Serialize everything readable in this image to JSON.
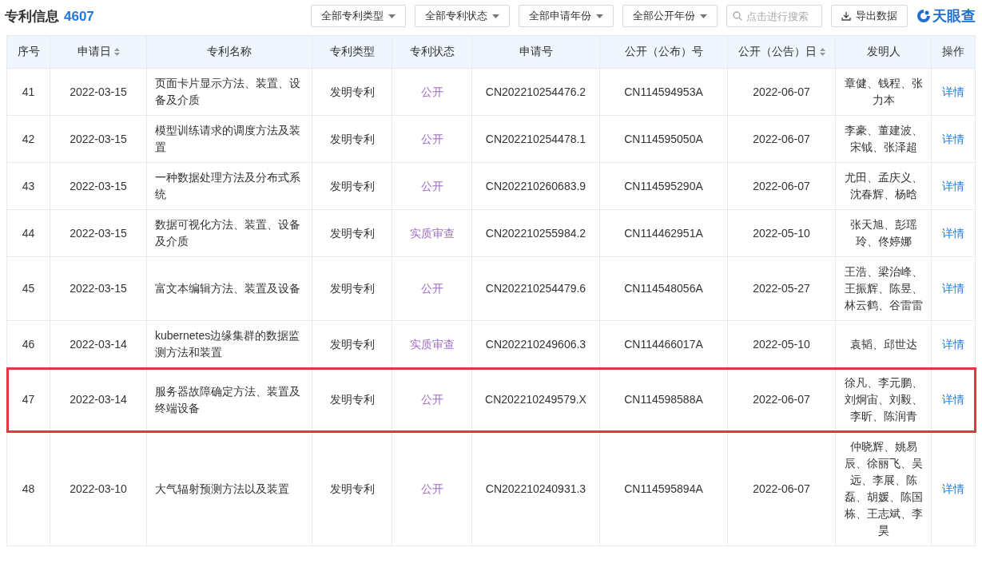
{
  "header": {
    "title": "专利信息",
    "count": "4607"
  },
  "filters": [
    {
      "label": "全部专利类型"
    },
    {
      "label": "全部专利状态"
    },
    {
      "label": "全部申请年份"
    },
    {
      "label": "全部公开年份"
    }
  ],
  "search": {
    "placeholder": "点击进行搜索"
  },
  "export_button": "导出数据",
  "logo": {
    "text": "天眼查"
  },
  "table": {
    "columns": [
      {
        "label": "序号",
        "sortable": false
      },
      {
        "label": "申请日",
        "sortable": true
      },
      {
        "label": "专利名称",
        "sortable": false
      },
      {
        "label": "专利类型",
        "sortable": false
      },
      {
        "label": "专利状态",
        "sortable": false
      },
      {
        "label": "申请号",
        "sortable": false
      },
      {
        "label": "公开（公布）号",
        "sortable": false
      },
      {
        "label": "公开（公告）日",
        "sortable": true
      },
      {
        "label": "发明人",
        "sortable": false
      },
      {
        "label": "操作",
        "sortable": false
      }
    ],
    "rows": [
      {
        "no": "41",
        "date": "2022-03-15",
        "name": "页面卡片显示方法、装置、设备及介质",
        "type": "发明专利",
        "status": "公开",
        "app_no": "CN202210254476.2",
        "pub_no": "CN114594953A",
        "pub_date": "2022-06-07",
        "inventors": "章健、钱程、张力本",
        "action": "详情",
        "highlighted": false
      },
      {
        "no": "42",
        "date": "2022-03-15",
        "name": "模型训练请求的调度方法及装置",
        "type": "发明专利",
        "status": "公开",
        "app_no": "CN202210254478.1",
        "pub_no": "CN114595050A",
        "pub_date": "2022-06-07",
        "inventors": "李豪、董建波、宋钺、张泽超",
        "action": "详情",
        "highlighted": false
      },
      {
        "no": "43",
        "date": "2022-03-15",
        "name": "一种数据处理方法及分布式系统",
        "type": "发明专利",
        "status": "公开",
        "app_no": "CN202210260683.9",
        "pub_no": "CN114595290A",
        "pub_date": "2022-06-07",
        "inventors": "尤田、孟庆义、沈春辉、杨晗",
        "action": "详情",
        "highlighted": false
      },
      {
        "no": "44",
        "date": "2022-03-15",
        "name": "数据可视化方法、装置、设备及介质",
        "type": "发明专利",
        "status": "实质审查",
        "app_no": "CN202210255984.2",
        "pub_no": "CN114462951A",
        "pub_date": "2022-05-10",
        "inventors": "张天旭、彭瑶玲、佟婷娜",
        "action": "详情",
        "highlighted": false
      },
      {
        "no": "45",
        "date": "2022-03-15",
        "name": "富文本编辑方法、装置及设备",
        "type": "发明专利",
        "status": "公开",
        "app_no": "CN202210254479.6",
        "pub_no": "CN114548056A",
        "pub_date": "2022-05-27",
        "inventors": "王浩、梁治峰、王振辉、陈昱、林云鹤、谷雷雷",
        "action": "详情",
        "highlighted": false
      },
      {
        "no": "46",
        "date": "2022-03-14",
        "name": "kubernetes边缘集群的数据监测方法和装置",
        "type": "发明专利",
        "status": "实质审查",
        "app_no": "CN202210249606.3",
        "pub_no": "CN114466017A",
        "pub_date": "2022-05-10",
        "inventors": "袁韬、邱世达",
        "action": "详情",
        "highlighted": false
      },
      {
        "no": "47",
        "date": "2022-03-14",
        "name": "服务器故障确定方法、装置及终端设备",
        "type": "发明专利",
        "status": "公开",
        "app_no": "CN202210249579.X",
        "pub_no": "CN114598588A",
        "pub_date": "2022-06-07",
        "inventors": "徐凡、李元鹏、刘炯宙、刘毅、李昕、陈润青",
        "action": "详情",
        "highlighted": true
      },
      {
        "no": "48",
        "date": "2022-03-10",
        "name": "大气辐射预测方法以及装置",
        "type": "发明专利",
        "status": "公开",
        "app_no": "CN202210240931.3",
        "pub_no": "CN114595894A",
        "pub_date": "2022-06-07",
        "inventors": "仲晓辉、姚易辰、徐丽飞、吴远、李展、陈磊、胡媛、陈国栋、王志斌、李昊",
        "action": "详情",
        "highlighted": false
      }
    ]
  }
}
